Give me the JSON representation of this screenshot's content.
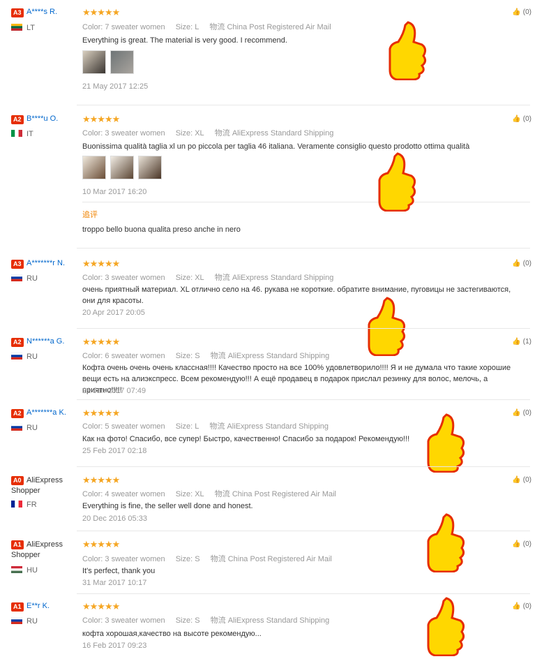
{
  "labels": {
    "color": "Color:",
    "size": "Size:",
    "shipping_prefix": "物流"
  },
  "reviews": [
    {
      "level": "A3",
      "name": "A****s R.",
      "country": "LT",
      "flag": [
        "#fdb913",
        "#006a44",
        "#c1272d"
      ],
      "flagdir": "h",
      "stars": "★★★★★",
      "color": "7 sweater women",
      "size": "L",
      "shipping": "China Post Registered Air Mail",
      "text": "Everything is great. The material is very good. I recommend.",
      "date": "21 May 2017 12:25",
      "useful": "(0)",
      "photos": 2
    },
    {
      "level": "A2",
      "name": "B****u O.",
      "country": "IT",
      "flag": [
        "#009246",
        "#ffffff",
        "#ce2b37"
      ],
      "flagdir": "v",
      "stars": "★★★★★",
      "color": "3 sweater women",
      "size": "XL",
      "shipping": "AliExpress Standard Shipping",
      "text": "Buonissima qualità taglia xl un po piccola per taglia 46 italiana. Veramente consiglio questo prodotto ottima qualità",
      "date": "10 Mar 2017 16:20",
      "useful": "(0)",
      "photos": 3,
      "additional_label": "追评",
      "additional_text": "troppo bello buona qualita preso anche in nero"
    },
    {
      "level": "A3",
      "name": "A*******r N.",
      "country": "RU",
      "flag": [
        "#ffffff",
        "#0039a6",
        "#d52b1e"
      ],
      "flagdir": "h",
      "stars": "★★★★★",
      "color": "3 sweater women",
      "size": "XL",
      "shipping": "AliExpress Standard Shipping",
      "text": "очень приятный материал. XL отлично село на 46. рукава не короткие. обратите внимание, пуговицы не застегиваются, они для красоты.",
      "date": "20 Apr 2017 20:05",
      "useful": "(0)",
      "photos": 0
    },
    {
      "level": "A2",
      "name": "N******a G.",
      "country": "RU",
      "flag": [
        "#ffffff",
        "#0039a6",
        "#d52b1e"
      ],
      "flagdir": "h",
      "stars": "★★★★★",
      "color": "6 sweater women",
      "size": "S",
      "shipping": "AliExpress Standard Shipping",
      "text": "Кофта очень очень очень классная!!!! Качество просто на все 100% удовлетворило!!!! Я и не думала что такие хорошие вещи есть на алиэкспресс. Всем рекомендую!!! А ещё продавец в подарок прислал резинку для волос, мелочь, а приятно!!!!!",
      "date": "21 Jan 2017 07:49",
      "useful": "(1)",
      "photos": 0
    },
    {
      "level": "A2",
      "name": "A*******a K.",
      "country": "RU",
      "flag": [
        "#ffffff",
        "#0039a6",
        "#d52b1e"
      ],
      "flagdir": "h",
      "stars": "★★★★★",
      "color": "5 sweater women",
      "size": "L",
      "shipping": "AliExpress Standard Shipping",
      "text": "Как на фото! Спасибо, все супер! Быстро, качественно! Спасибо за подарок! Рекомендую!!!",
      "date": "25 Feb 2017 02:18",
      "useful": "(0)",
      "photos": 0
    },
    {
      "level": "A0",
      "name": "AliExpress Shopper",
      "country": "FR",
      "flag": [
        "#002395",
        "#ffffff",
        "#ed2939"
      ],
      "flagdir": "v",
      "stars": "★★★★★",
      "color": "4 sweater women",
      "size": "XL",
      "shipping": "China Post Registered Air Mail",
      "text": "Everything is fine, the seller well done and honest.",
      "date": "20 Dec 2016 05:33",
      "useful": "(0)",
      "photos": 0
    },
    {
      "level": "A1",
      "name": "AliExpress Shopper",
      "country": "HU",
      "flag": [
        "#ce2939",
        "#ffffff",
        "#477050"
      ],
      "flagdir": "h",
      "stars": "★★★★★",
      "color": "3 sweater women",
      "size": "S",
      "shipping": "China Post Registered Air Mail",
      "text": "It's perfect, thank you",
      "date": "31 Mar 2017 10:17",
      "useful": "(0)",
      "photos": 0
    },
    {
      "level": "A1",
      "name": "E**r K.",
      "country": "RU",
      "flag": [
        "#ffffff",
        "#0039a6",
        "#d52b1e"
      ],
      "flagdir": "h",
      "stars": "★★★★★",
      "color": "3 sweater women",
      "size": "S",
      "shipping": "AliExpress Standard Shipping",
      "text": "кофта хорошая,качество на высоте рекомендую...",
      "date": "16 Feb 2017 09:23",
      "useful": "(0)",
      "photos": 0
    }
  ]
}
